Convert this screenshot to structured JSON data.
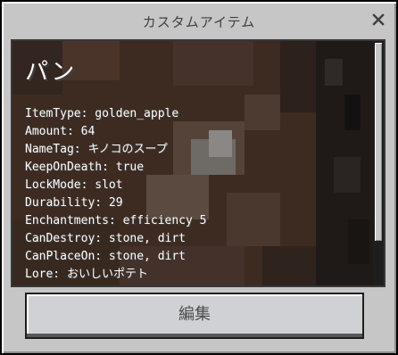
{
  "dialog": {
    "title": "カスタムアイテム",
    "close_icon": "close-icon"
  },
  "item": {
    "name": "パン",
    "properties": [
      "ItemType: golden_apple",
      "Amount: 64",
      "NameTag: キノコのスープ",
      "KeepOnDeath: true",
      "LockMode: slot",
      "Durability: 29",
      "Enchantments: efficiency 5",
      "CanDestroy: stone, dirt",
      "CanPlaceOn: stone, dirt",
      "Lore: おいしいポテト"
    ]
  },
  "actions": {
    "edit_label": "編集"
  },
  "colors": {
    "frame": "#c6c6c6",
    "panel_background": "#3b2a22",
    "text": "#ffffff",
    "button": "#d0d1d4"
  }
}
